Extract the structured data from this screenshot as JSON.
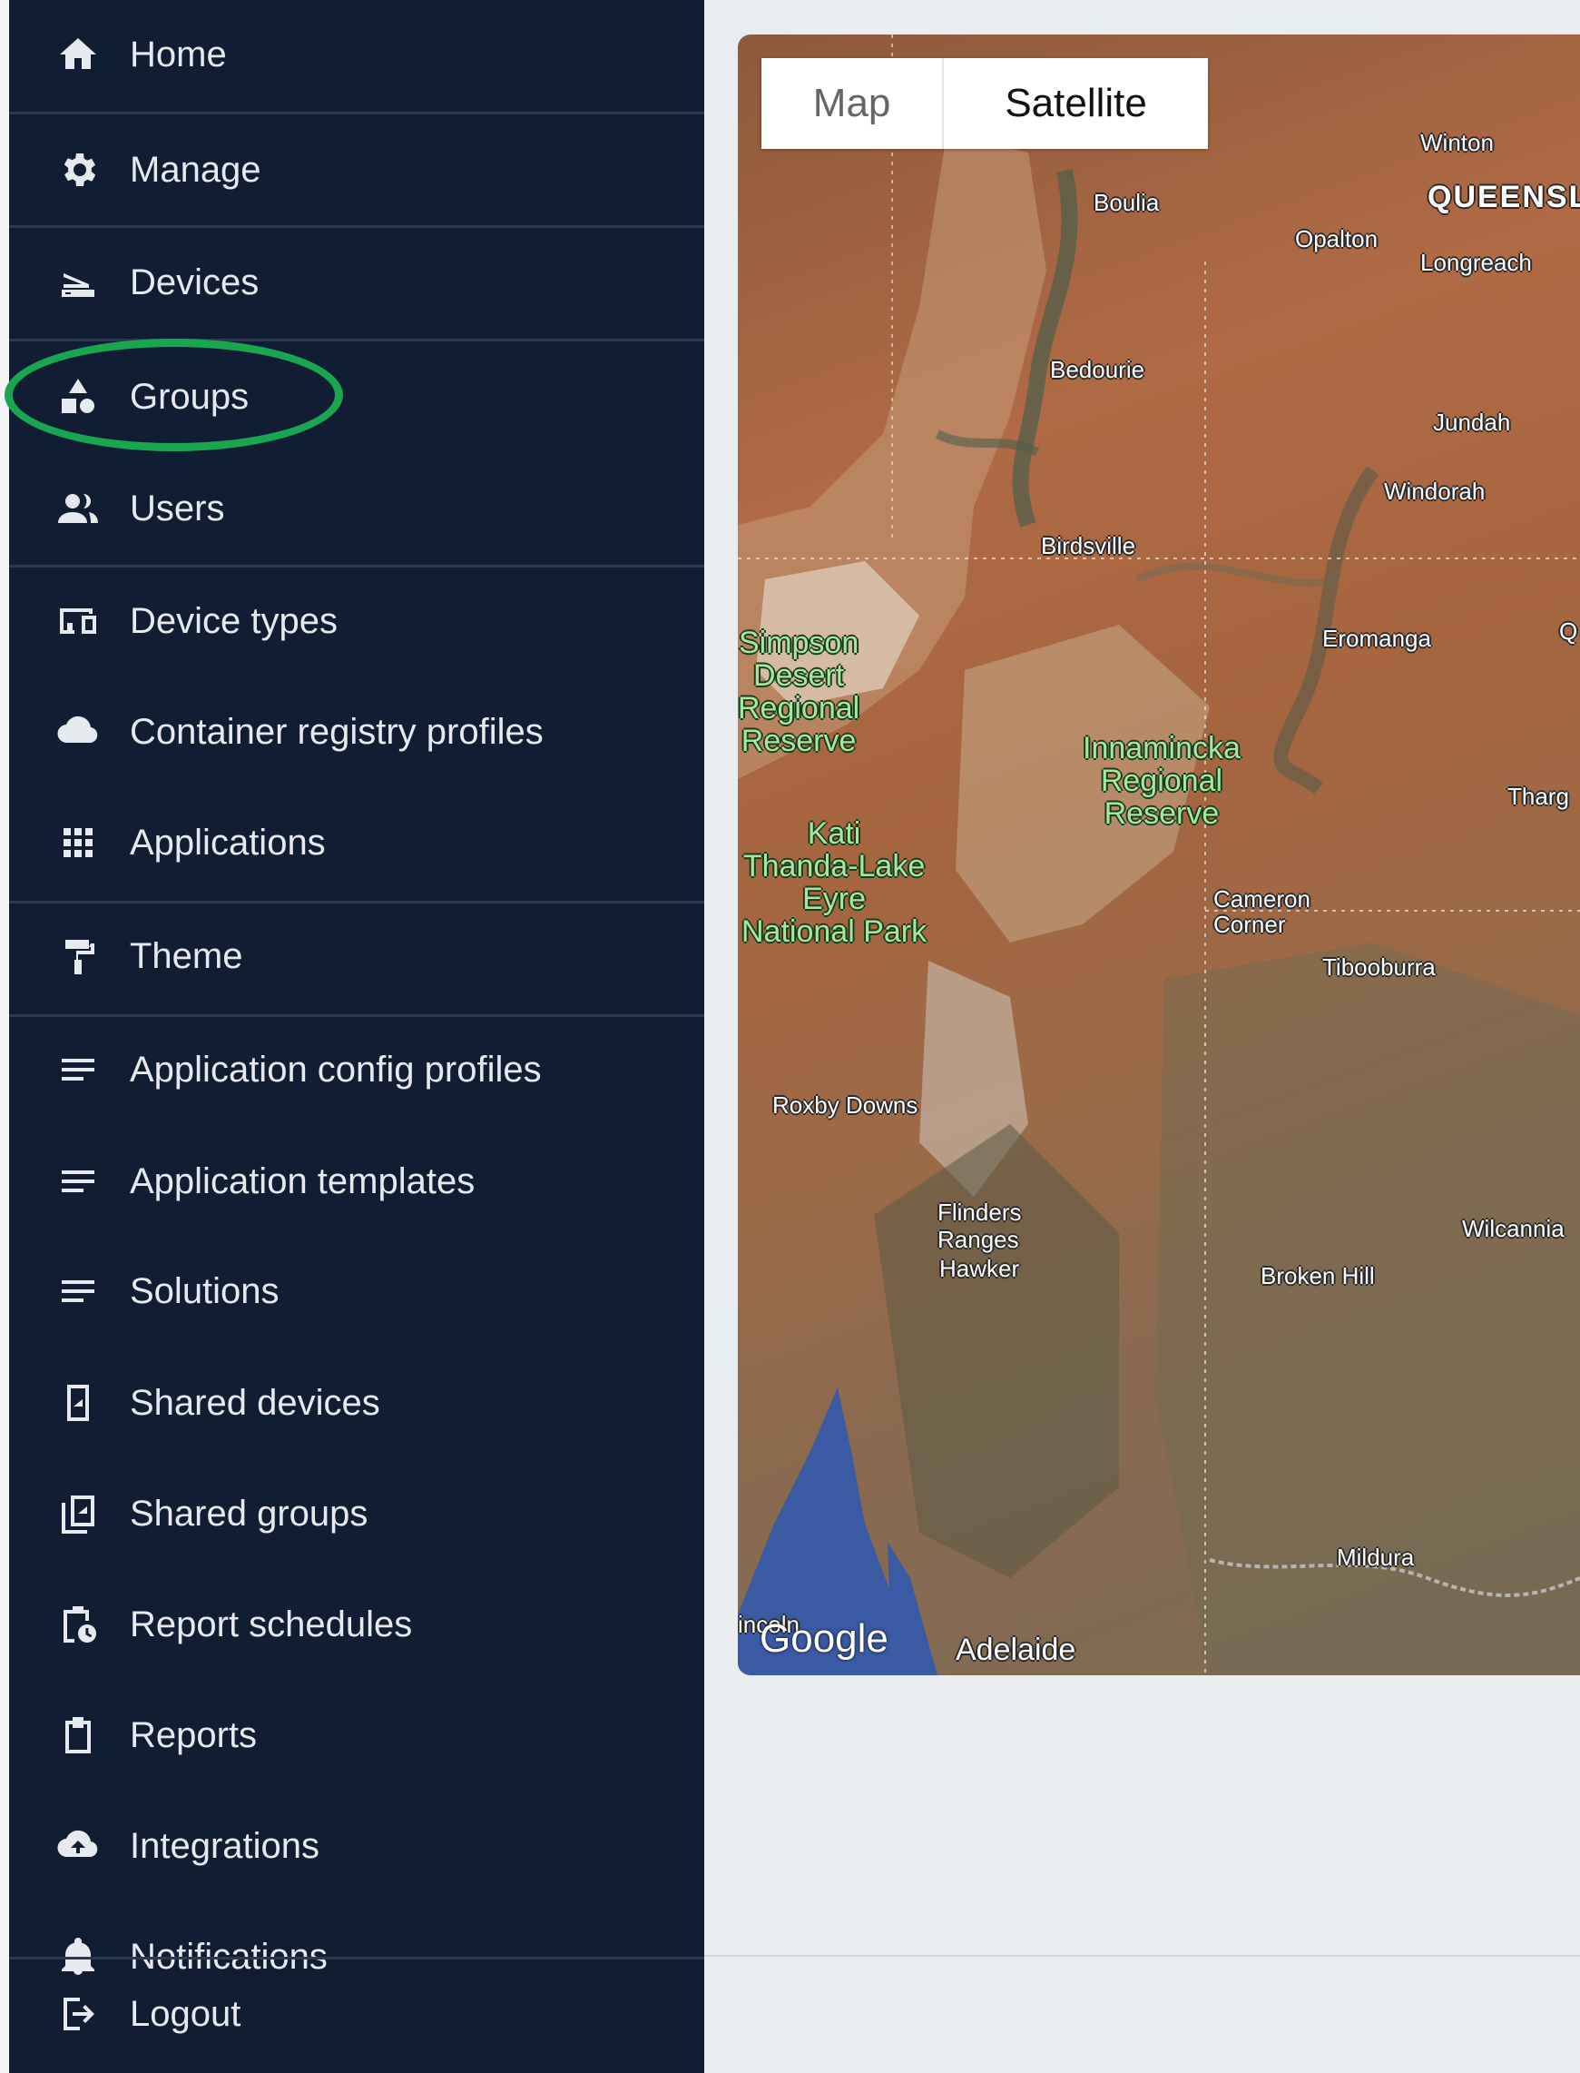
{
  "sidebar": {
    "items": [
      {
        "label": "Home",
        "icon": "home-icon"
      },
      {
        "label": "Manage",
        "icon": "gear-icon"
      },
      {
        "label": "Devices",
        "icon": "router-icon"
      },
      {
        "label": "Groups",
        "icon": "shapes-icon"
      },
      {
        "label": "Users",
        "icon": "users-icon"
      },
      {
        "label": "Device types",
        "icon": "devices-icon"
      },
      {
        "label": "Container registry profiles",
        "icon": "cloud-icon"
      },
      {
        "label": "Applications",
        "icon": "apps-grid-icon"
      },
      {
        "label": "Theme",
        "icon": "paint-roller-icon"
      },
      {
        "label": "Application config profiles",
        "icon": "lines-icon"
      },
      {
        "label": "Application templates",
        "icon": "lines-icon"
      },
      {
        "label": "Solutions",
        "icon": "lines-icon"
      },
      {
        "label": "Shared devices",
        "icon": "shared-device-icon"
      },
      {
        "label": "Shared groups",
        "icon": "shared-groups-icon"
      },
      {
        "label": "Report schedules",
        "icon": "clipboard-clock-icon"
      },
      {
        "label": "Reports",
        "icon": "clipboard-icon"
      },
      {
        "label": "Integrations",
        "icon": "cloud-upload-icon"
      },
      {
        "label": "Notifications",
        "icon": "bell-icon"
      },
      {
        "label": "Logout",
        "icon": "logout-icon"
      }
    ],
    "highlighted_item": "Groups",
    "highlight_color": "#1aa551"
  },
  "map": {
    "type_control": {
      "map_label": "Map",
      "satellite_label": "Satellite",
      "selected": "Satellite"
    },
    "places": {
      "winton": "Winton",
      "queensland": "QUEENSL",
      "boulia": "Boulia",
      "opalton": "Opalton",
      "longreach": "Longreach",
      "bedourie": "Bedourie",
      "jundah": "Jundah",
      "windorah": "Windorah",
      "birdsville": "Birdsville",
      "eromanga": "Eromanga",
      "qu": "Q",
      "thargomindah": "Tharg",
      "cameron_corner": "Cameron\nCorner",
      "tibooburra": "Tibooburra",
      "roxby_downs": "Roxby Downs",
      "flinders_ranges": "Flinders\nRanges",
      "hawker": "Hawker",
      "wilcannia": "Wilcannia",
      "broken_hill": "Broken Hill",
      "mildura": "Mildura",
      "lincoln": "incoln",
      "adelaide": "Adelaide"
    },
    "parks": {
      "simpson": "Simpson\nDesert\nRegional\nReserve",
      "kati_thanda": "Kati\nThanda-Lake\nEyre\nNational Park",
      "innamincka": "Innamincka\nRegional\nReserve"
    },
    "attribution": "Google"
  },
  "colors": {
    "sidebar_bg": "#111d33",
    "sidebar_text": "#e6e9ee",
    "page_bg": "#e9edf0"
  }
}
